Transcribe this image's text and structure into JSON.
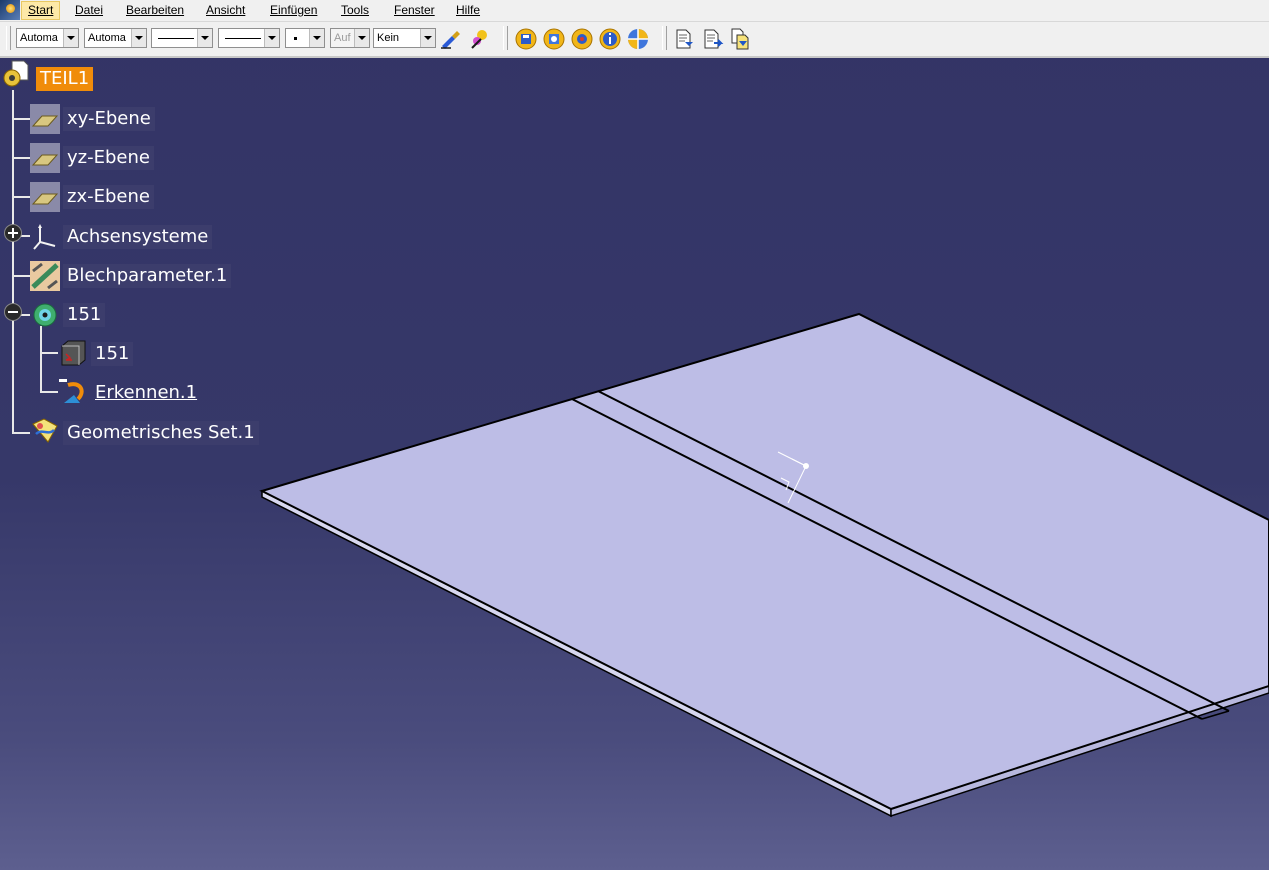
{
  "menu": {
    "items": [
      {
        "label": "Start",
        "active": true
      },
      {
        "label": "Datei"
      },
      {
        "label": "Bearbeiten"
      },
      {
        "label": "Ansicht"
      },
      {
        "label": "Einfügen"
      },
      {
        "label": "Tools"
      },
      {
        "label": "Fenster"
      },
      {
        "label": "Hilfe"
      }
    ]
  },
  "toolbar": {
    "color_combo": "Automa",
    "fill_combo": "Automa",
    "layer_combo": "Auf",
    "render_combo": "Kein",
    "icons": [
      "paint-brush-icon",
      "magic-wand-icon",
      "save-icon",
      "save-as-icon",
      "settings-icon",
      "info-icon",
      "view-quadrant-icon",
      "document-arrow-icon",
      "document-export-icon",
      "document-compare-icon"
    ]
  },
  "tree": {
    "root": "TEIL1",
    "nodes": [
      {
        "label": "xy-Ebene",
        "icon": "plane-icon"
      },
      {
        "label": "yz-Ebene",
        "icon": "plane-icon"
      },
      {
        "label": "zx-Ebene",
        "icon": "plane-icon"
      },
      {
        "label": "Achsensysteme",
        "icon": "axis-system-icon",
        "expander": "plus"
      },
      {
        "label": "Blechparameter.1",
        "icon": "sheet-metal-params-icon"
      },
      {
        "label": "151",
        "icon": "part-body-icon",
        "expander": "minus"
      },
      {
        "label": "151",
        "icon": "solid-icon",
        "child": true
      },
      {
        "label": "Erkennen.1",
        "icon": "recognize-icon",
        "child": true,
        "underline": true
      },
      {
        "label": "Geometrisches Set.1",
        "icon": "geometric-set-icon"
      }
    ]
  },
  "colors": {
    "background_top": "#333466",
    "background_bottom": "#5d5f8f",
    "plate_face": "#bdbde6",
    "selection": "#f08c0a"
  }
}
